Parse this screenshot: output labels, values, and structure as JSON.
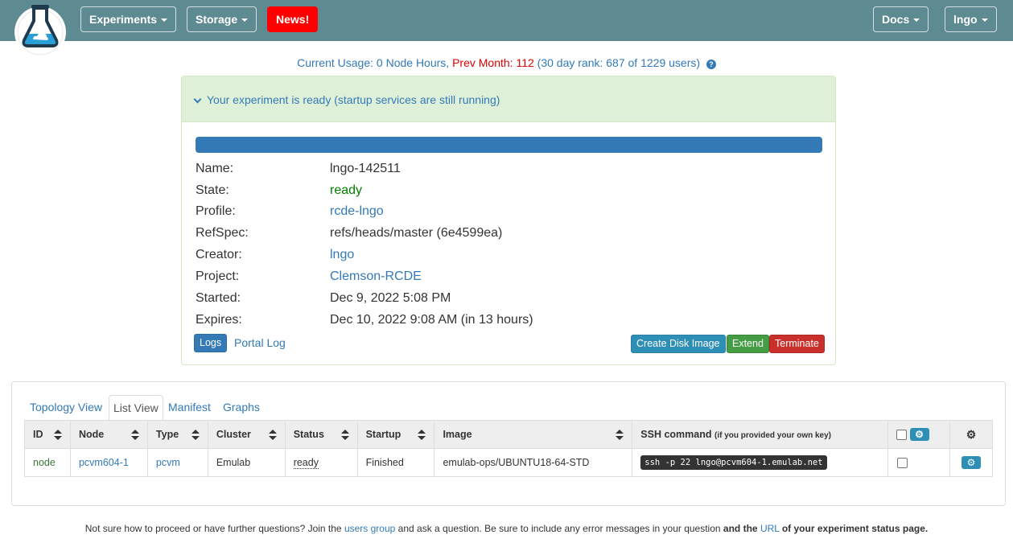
{
  "navbar": {
    "experiments_label": "Experiments",
    "storage_label": "Storage",
    "news_label": "News!",
    "docs_label": "Docs",
    "user_label": "lngo",
    "bg_color": "#5e8a91",
    "news_color": "#ff0000"
  },
  "usage": {
    "current_prefix": "Current Usage:",
    "current_value": "0 Node Hours,",
    "prev_label": "Prev Month:",
    "prev_value": "112",
    "rank_text": "(30 day rank: 687 of 1229 users)",
    "help_icon": "?"
  },
  "status_panel": {
    "heading": "Your experiment is ready (startup services are still running)",
    "progress_percent": 100,
    "fields": {
      "name_label": "Name:",
      "name_value": "lngo-142511",
      "state_label": "State:",
      "state_value": "ready",
      "profile_label": "Profile:",
      "profile_value": "rcde-lngo",
      "refspec_label": "RefSpec:",
      "refspec_value": "refs/heads/master (6e4599ea)",
      "creator_label": "Creator:",
      "creator_value": "lngo",
      "project_label": "Project:",
      "project_value": "Clemson-RCDE",
      "started_label": "Started:",
      "started_value": "Dec 9, 2022 5:08 PM",
      "expires_label": "Expires:",
      "expires_value": "Dec 10, 2022 9:08 AM (in 13 hours)"
    },
    "logs_label": "Logs",
    "portal_log_label": "Portal Log",
    "create_disk_image_label": "Create Disk Image",
    "extend_label": "Extend",
    "terminate_label": "Terminate"
  },
  "tabs": {
    "topology": "Topology View",
    "list": "List View",
    "manifest": "Manifest",
    "graphs": "Graphs"
  },
  "table": {
    "headers": {
      "id": "ID",
      "node": "Node",
      "type": "Type",
      "cluster": "Cluster",
      "status": "Status",
      "startup": "Startup",
      "image": "Image",
      "ssh": "SSH command",
      "ssh_note": "(if you provided your own key)"
    },
    "rows": [
      {
        "id": "node",
        "node": "pcvm604-1",
        "type": "pcvm",
        "cluster": "Emulab",
        "status": "ready",
        "startup": "Finished",
        "image": "emulab-ops/UBUNTU18-64-STD",
        "ssh": "ssh -p 22 lngo@pcvm604-1.emulab.net"
      }
    ]
  },
  "footer": {
    "text1": "Not sure how to proceed or have further questions? Join the",
    "users_group": "users group",
    "text2": "and ask a question. Be sure to include any error messages in your question",
    "text3": "and the",
    "url": "URL",
    "text4": "of your experiment status page."
  }
}
